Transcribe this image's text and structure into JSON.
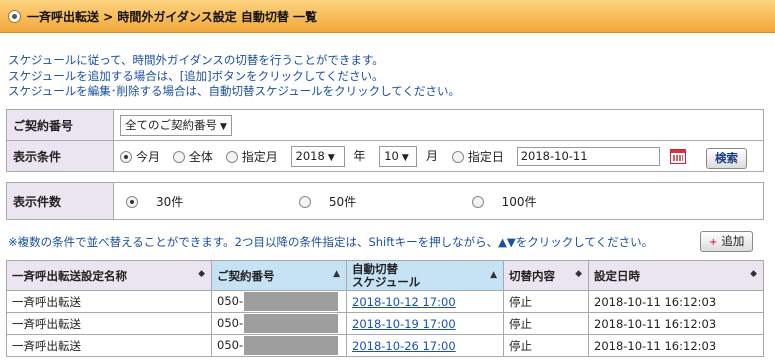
{
  "header": {
    "title": "一斉呼出転送 > 時間外ガイダンス設定  自動切替  一覧"
  },
  "description": [
    "スケジュールに従って、時間外ガイダンスの切替を行うことができます。",
    "スケジュールを追加する場合は、[追加]ボタンをクリックしてください。",
    "スケジュールを編集･削除する場合は、自動切替スケジュールをクリックしてください。"
  ],
  "form": {
    "contract_label": "ご契約番号",
    "contract_select": "全てのご契約番号",
    "condition_label": "表示条件",
    "options": {
      "this_month": "今月",
      "all": "全体",
      "month": "指定月",
      "day": "指定日"
    },
    "selected_option": "this_month",
    "year_value": "2018",
    "year_unit": "年",
    "month_value": "10",
    "month_unit": "月",
    "date_value": "2018-10-11",
    "search_label": "検索",
    "count_label": "表示件数",
    "counts": [
      "30件",
      "50件",
      "100件"
    ],
    "selected_count": "30件"
  },
  "note": "※複数の条件で並べ替えることができます。2つ目以降の条件指定は、Shiftキーを押しながら、▲▼をクリックしてください。",
  "add_label": "追加",
  "table": {
    "headers": {
      "name": "一斉呼出転送設定名称",
      "contract": "ご契約番号",
      "schedule_line1": "自動切替",
      "schedule_line2": "スケジュール",
      "content": "切替内容",
      "date": "設定日時"
    },
    "rows": [
      {
        "name": "一斉呼出転送",
        "contract_prefix": "050-",
        "schedule": "2018-10-12 17:00",
        "content": "停止",
        "date": "2018-10-11 16:12:03"
      },
      {
        "name": "一斉呼出転送",
        "contract_prefix": "050-",
        "schedule": "2018-10-19 17:00",
        "content": "停止",
        "date": "2018-10-11 16:12:03"
      },
      {
        "name": "一斉呼出転送",
        "contract_prefix": "050-",
        "schedule": "2018-10-26 17:00",
        "content": "停止",
        "date": "2018-10-11 16:12:03"
      }
    ]
  }
}
